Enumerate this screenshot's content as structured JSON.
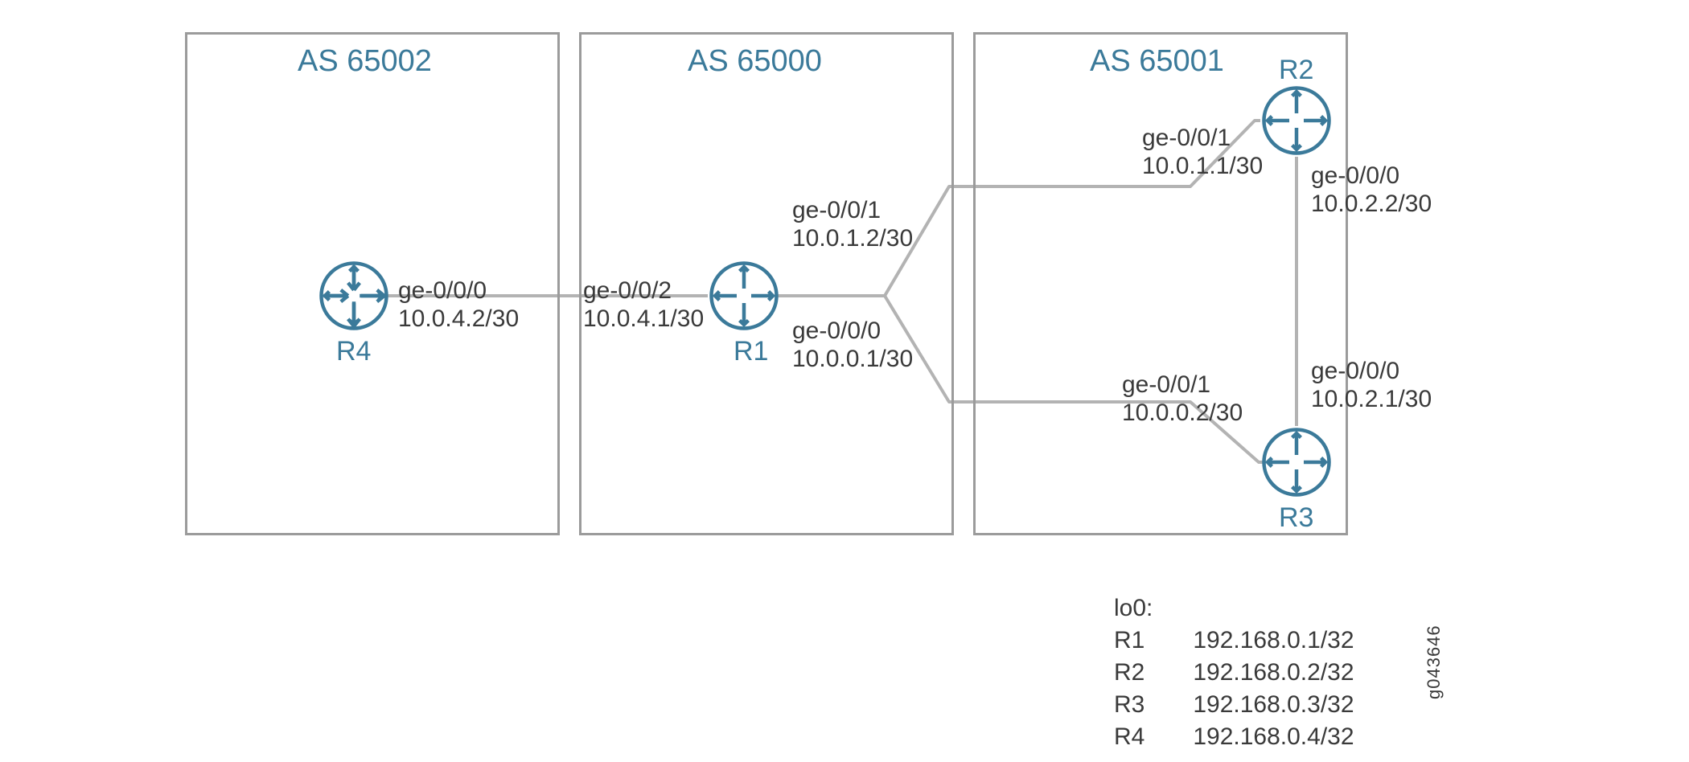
{
  "as": {
    "left": {
      "title": "AS 65002"
    },
    "middle": {
      "title": "AS 65000"
    },
    "right": {
      "title": "AS 65001"
    }
  },
  "routers": {
    "r1": {
      "name": "R1"
    },
    "r2": {
      "name": "R2"
    },
    "r3": {
      "name": "R3"
    },
    "r4": {
      "name": "R4"
    }
  },
  "interfaces": {
    "r4_ge000": {
      "name": "ge-0/0/0",
      "addr": "10.0.4.2/30"
    },
    "r1_ge002": {
      "name": "ge-0/0/2",
      "addr": "10.0.4.1/30"
    },
    "r1_ge001": {
      "name": "ge-0/0/1",
      "addr": "10.0.1.2/30"
    },
    "r1_ge000": {
      "name": "ge-0/0/0",
      "addr": "10.0.0.1/30"
    },
    "r2_ge001": {
      "name": "ge-0/0/1",
      "addr": "10.0.1.1/30"
    },
    "r2_ge000": {
      "name": "ge-0/0/0",
      "addr": "10.0.2.2/30"
    },
    "r3_ge001": {
      "name": "ge-0/0/1",
      "addr": "10.0.0.2/30"
    },
    "r3_ge000": {
      "name": "ge-0/0/0",
      "addr": "10.0.2.1/30"
    }
  },
  "loopbacks": {
    "title": "lo0:",
    "rows": [
      {
        "name": "R1",
        "addr": "192.168.0.1/32"
      },
      {
        "name": "R2",
        "addr": "192.168.0.2/32"
      },
      {
        "name": "R3",
        "addr": "192.168.0.3/32"
      },
      {
        "name": "R4",
        "addr": "192.168.0.4/32"
      }
    ]
  },
  "figure_id": "g043646"
}
